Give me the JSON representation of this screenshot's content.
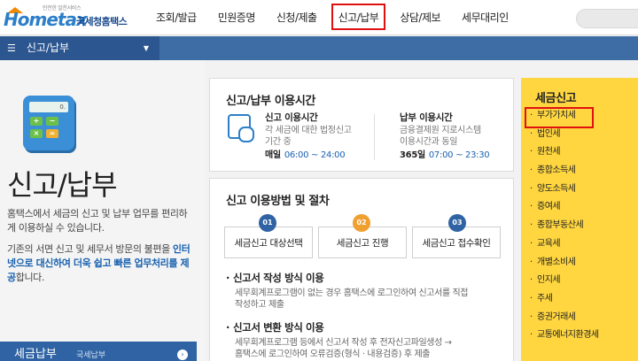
{
  "logo": {
    "subtitle": "안전한 알찬서비스",
    "brand": "Hometax",
    "kr_name": "국세청홈택스"
  },
  "gnb": [
    {
      "label": "조회/발급",
      "highlight": false
    },
    {
      "label": "민원증명",
      "highlight": false
    },
    {
      "label": "신청/제출",
      "highlight": false
    },
    {
      "label": "신고/납부",
      "highlight": true
    },
    {
      "label": "상담/제보",
      "highlight": false
    },
    {
      "label": "세무대리인",
      "highlight": false
    }
  ],
  "subbar": {
    "menu_label": "신고/납부"
  },
  "left": {
    "calc_display": "0.",
    "title": "신고/납부",
    "desc1": "홈택스에서 세금의 신고 및 납부 업무를 편리하게 이용하실 수 있습니다.",
    "desc2_prefix": "기존의 서면 신고 및 세무서 방문의 불편을 ",
    "desc2_em": "인터넷으로 대신하여 더욱 쉽고 빠른 업무처리를 제공",
    "desc2_suffix": "합니다.",
    "bottom_label": "세금납부",
    "bottom_small": "국세납부"
  },
  "card1": {
    "title": "신고/납부 이용시간",
    "col1": {
      "heading": "신고 이용시간",
      "line1": "각 세금에 대한 법정신고",
      "line2": "기간 중",
      "day": "매일",
      "time": "06:00 ~ 24:00"
    },
    "col2": {
      "heading": "납부 이용시간",
      "line1": "금융결제원 지로시스템",
      "line2": "이용시간과 동일",
      "day": "365일",
      "time": "07:00 ~ 23:30"
    }
  },
  "card2": {
    "title": "신고 이용방법 및 절차",
    "steps": [
      {
        "num": "01",
        "label": "세금신고 대상선택",
        "color": "#2f63a3"
      },
      {
        "num": "02",
        "label": "세금신고 진행",
        "color": "#f0a030"
      },
      {
        "num": "03",
        "label": "세금신고 접수확인",
        "color": "#2f63a3"
      }
    ],
    "section1": {
      "heading": "신고서 작성 방식 이용",
      "line1": "세무회계프로그램이 없는 경우 홈택스에 로그인하여 신고서를 직접",
      "line2": "작성하고 제출"
    },
    "section2": {
      "heading": "신고서 변환 방식 이용",
      "line1": "세무회계프로그램 등에서 신고서 작성 후 전자신고파일생성 →",
      "line2": "홈택스에 로그인하여 오류검증(형식 · 내용검증) 후 제출"
    }
  },
  "tax_menu": {
    "title": "세금신고",
    "items": [
      {
        "label": "부가가치세",
        "highlight": true
      },
      {
        "label": "법인세",
        "highlight": false
      },
      {
        "label": "원천세",
        "highlight": false
      },
      {
        "label": "종합소득세",
        "highlight": false
      },
      {
        "label": "양도소득세",
        "highlight": false
      },
      {
        "label": "증여세",
        "highlight": false
      },
      {
        "label": "종합부동산세",
        "highlight": false
      },
      {
        "label": "교육세",
        "highlight": false
      },
      {
        "label": "개별소비세",
        "highlight": false
      },
      {
        "label": "인지세",
        "highlight": false
      },
      {
        "label": "주세",
        "highlight": false
      },
      {
        "label": "증권거래세",
        "highlight": false
      },
      {
        "label": "교통에너지환경세",
        "highlight": false
      }
    ]
  }
}
